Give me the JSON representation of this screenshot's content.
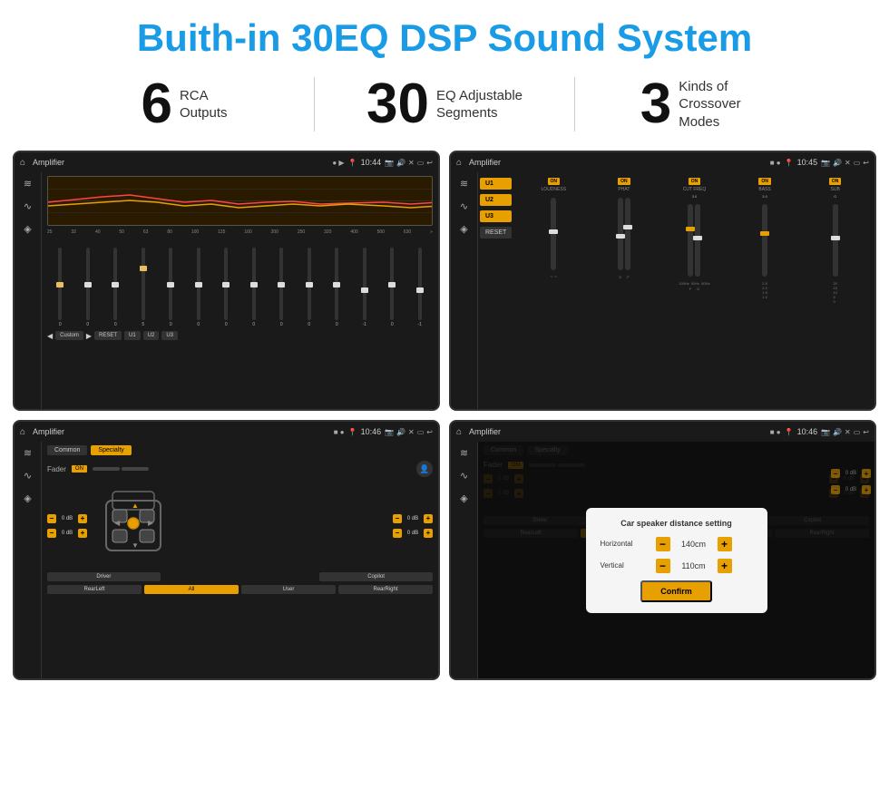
{
  "page": {
    "title": "Buith-in 30EQ DSP Sound System"
  },
  "stats": [
    {
      "number": "6",
      "label_line1": "RCA",
      "label_line2": "Outputs"
    },
    {
      "number": "30",
      "label_line1": "EQ Adjustable",
      "label_line2": "Segments"
    },
    {
      "number": "3",
      "label_line1": "Kinds of",
      "label_line2": "Crossover Modes"
    }
  ],
  "screens": {
    "top_left": {
      "topbar": {
        "title": "Amplifier",
        "time": "10:44"
      },
      "eq_freqs": [
        "25",
        "32",
        "40",
        "50",
        "63",
        "80",
        "100",
        "125",
        "160",
        "200",
        "250",
        "320",
        "400",
        "500",
        "630"
      ],
      "eq_vals": [
        "0",
        "0",
        "0",
        "5",
        "0",
        "0",
        "0",
        "0",
        "0",
        "0",
        "0",
        "-1",
        "0",
        "-1"
      ],
      "preset": "Custom",
      "buttons": [
        "RESET",
        "U1",
        "U2",
        "U3"
      ]
    },
    "top_right": {
      "topbar": {
        "title": "Amplifier",
        "time": "10:45"
      },
      "u_buttons": [
        "U1",
        "U2",
        "U3"
      ],
      "channels": [
        {
          "label": "LOUDNESS",
          "on": true
        },
        {
          "label": "PHAT",
          "on": true
        },
        {
          "label": "CUT FREQ",
          "on": true
        },
        {
          "label": "BASS",
          "on": true
        },
        {
          "label": "SUB",
          "on": true
        }
      ]
    },
    "bottom_left": {
      "topbar": {
        "title": "Amplifier",
        "time": "10:46"
      },
      "tabs": [
        "Common",
        "Specialty"
      ],
      "active_tab": "Specialty",
      "fader_label": "Fader",
      "fader_on": true,
      "speaker_rows": [
        {
          "left_db": "0 dB",
          "right_db": "0 dB"
        },
        {
          "left_db": "0 dB",
          "right_db": "0 dB"
        }
      ],
      "bottom_buttons": [
        "Driver",
        "",
        "Copilot",
        "RearLeft",
        "All",
        "User",
        "RearRight"
      ]
    },
    "bottom_right": {
      "topbar": {
        "title": "Amplifier",
        "time": "10:46"
      },
      "tabs": [
        "Common",
        "Specialty"
      ],
      "dialog": {
        "title": "Car speaker distance setting",
        "rows": [
          {
            "label": "Horizontal",
            "value": "140cm"
          },
          {
            "label": "Vertical",
            "value": "110cm"
          }
        ],
        "confirm_label": "Confirm"
      }
    }
  },
  "icons": {
    "home": "⌂",
    "location": "📍",
    "volume": "🔊",
    "back": "↩",
    "camera": "📷",
    "eq_icon": "≋",
    "wave_icon": "∿",
    "speaker_icon": "◈",
    "minus": "−",
    "plus": "+"
  }
}
